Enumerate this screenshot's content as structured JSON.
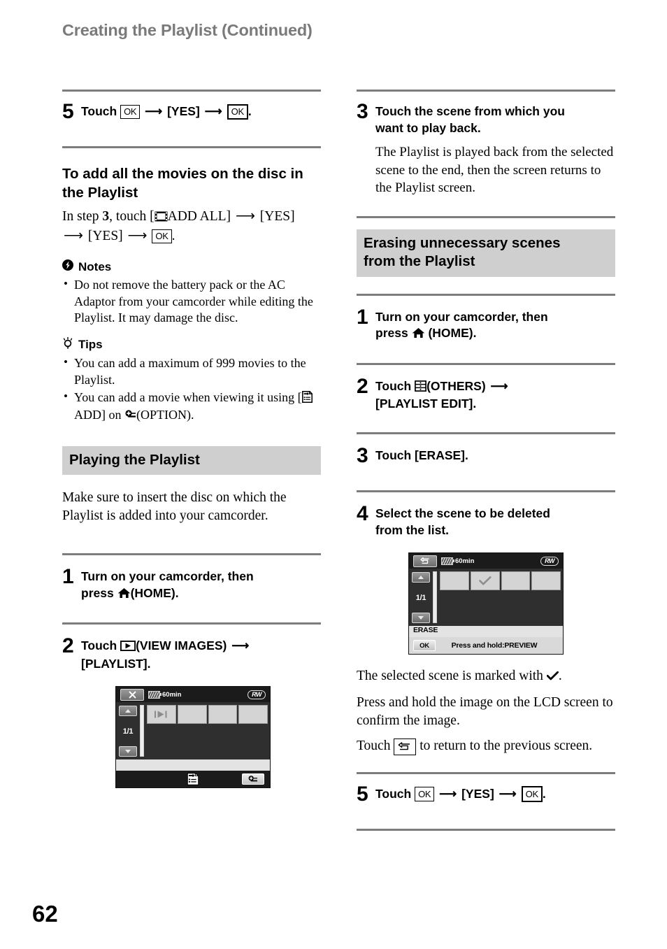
{
  "header": {
    "title": "Creating the Playlist (Continued)"
  },
  "page_number": "62",
  "left_column": {
    "step5": {
      "number": "5",
      "label_touch": "Touch",
      "ok_label": "OK",
      "yes_label": "[YES]",
      "ok_label2": "OK",
      "period": "."
    },
    "subsection": {
      "heading": "To add all the movies on the disc in the Playlist",
      "body_prefix": "In step ",
      "body_step": "3",
      "body_touch": ", touch [",
      "add_all_label": "ADD ALL]",
      "yes1": "[YES]",
      "yes2": "[YES]",
      "ok_label": "OK",
      "period": "."
    },
    "notes": {
      "heading": "Notes",
      "items": [
        "Do not remove the battery pack or the AC Adaptor from your camcorder while editing the Playlist. It may damage the disc."
      ]
    },
    "tips": {
      "heading": "Tips",
      "item1": "You can add a maximum of 999 movies to the Playlist.",
      "item2_pre": "You can add a movie when viewing it using [",
      "item2_add": "ADD] on ",
      "item2_post": "(OPTION)."
    },
    "section": {
      "heading": "Playing the Playlist",
      "intro": "Make sure to insert the disc on which the Playlist is added into your camcorder."
    },
    "step1": {
      "number": "1",
      "line1": "Turn on your camcorder, then",
      "line2_pre": "press ",
      "line2_post": "(HOME)."
    },
    "step2": {
      "number": "2",
      "touch": "Touch ",
      "view_images": "(VIEW IMAGES) ",
      "playlist": "[PLAYLIST]."
    },
    "lcd": {
      "battery_text": "60min",
      "disc_badge": "RW",
      "page_count": "1/1",
      "close_icon": "close-icon",
      "thumb1_icon": "movie-play-icon",
      "bottom_center_icon": "playlist-icon",
      "option_icon": "option-icon"
    }
  },
  "right_column": {
    "step3": {
      "number": "3",
      "line1": "Touch the scene from which you",
      "line2": "want to play back.",
      "desc": "The Playlist is played back from the selected scene to the end, then the screen returns to the Playlist screen."
    },
    "section": {
      "heading_line1": "Erasing unnecessary scenes",
      "heading_line2": "from the Playlist"
    },
    "step1": {
      "number": "1",
      "line1": "Turn on your camcorder, then",
      "line2_pre": "press ",
      "line2_post": "(HOME)."
    },
    "step2": {
      "number": "2",
      "touch": "Touch ",
      "others": "(OTHERS) ",
      "playlist_edit": "[PLAYLIST EDIT]."
    },
    "step3b": {
      "number": "3",
      "text": "Touch [ERASE]."
    },
    "step4": {
      "number": "4",
      "line1": "Select the scene to be deleted",
      "line2": "from the list."
    },
    "lcd": {
      "battery_text": "60min",
      "disc_badge": "RW",
      "page_count": "1/1",
      "back_icon": "return-icon",
      "check_icon": "check-icon",
      "erase_label": "ERASE",
      "ok_label": "OK",
      "hold_text": "Press and hold:PREVIEW"
    },
    "after_lcd": {
      "line1_pre": "The selected scene is marked with ",
      "line1_post": ".",
      "line2": "Press and hold the image on the LCD screen to confirm the image.",
      "line3_pre": "Touch ",
      "line3_post": " to return to the previous screen."
    },
    "step5": {
      "number": "5",
      "label_touch": "Touch",
      "ok_label": "OK",
      "yes_label": "[YES]",
      "ok_label2": "OK",
      "period": "."
    }
  },
  "colors": {
    "band": "#cfcfcf",
    "rule": "#7d7d7d",
    "header_text": "#7a7a7a"
  }
}
